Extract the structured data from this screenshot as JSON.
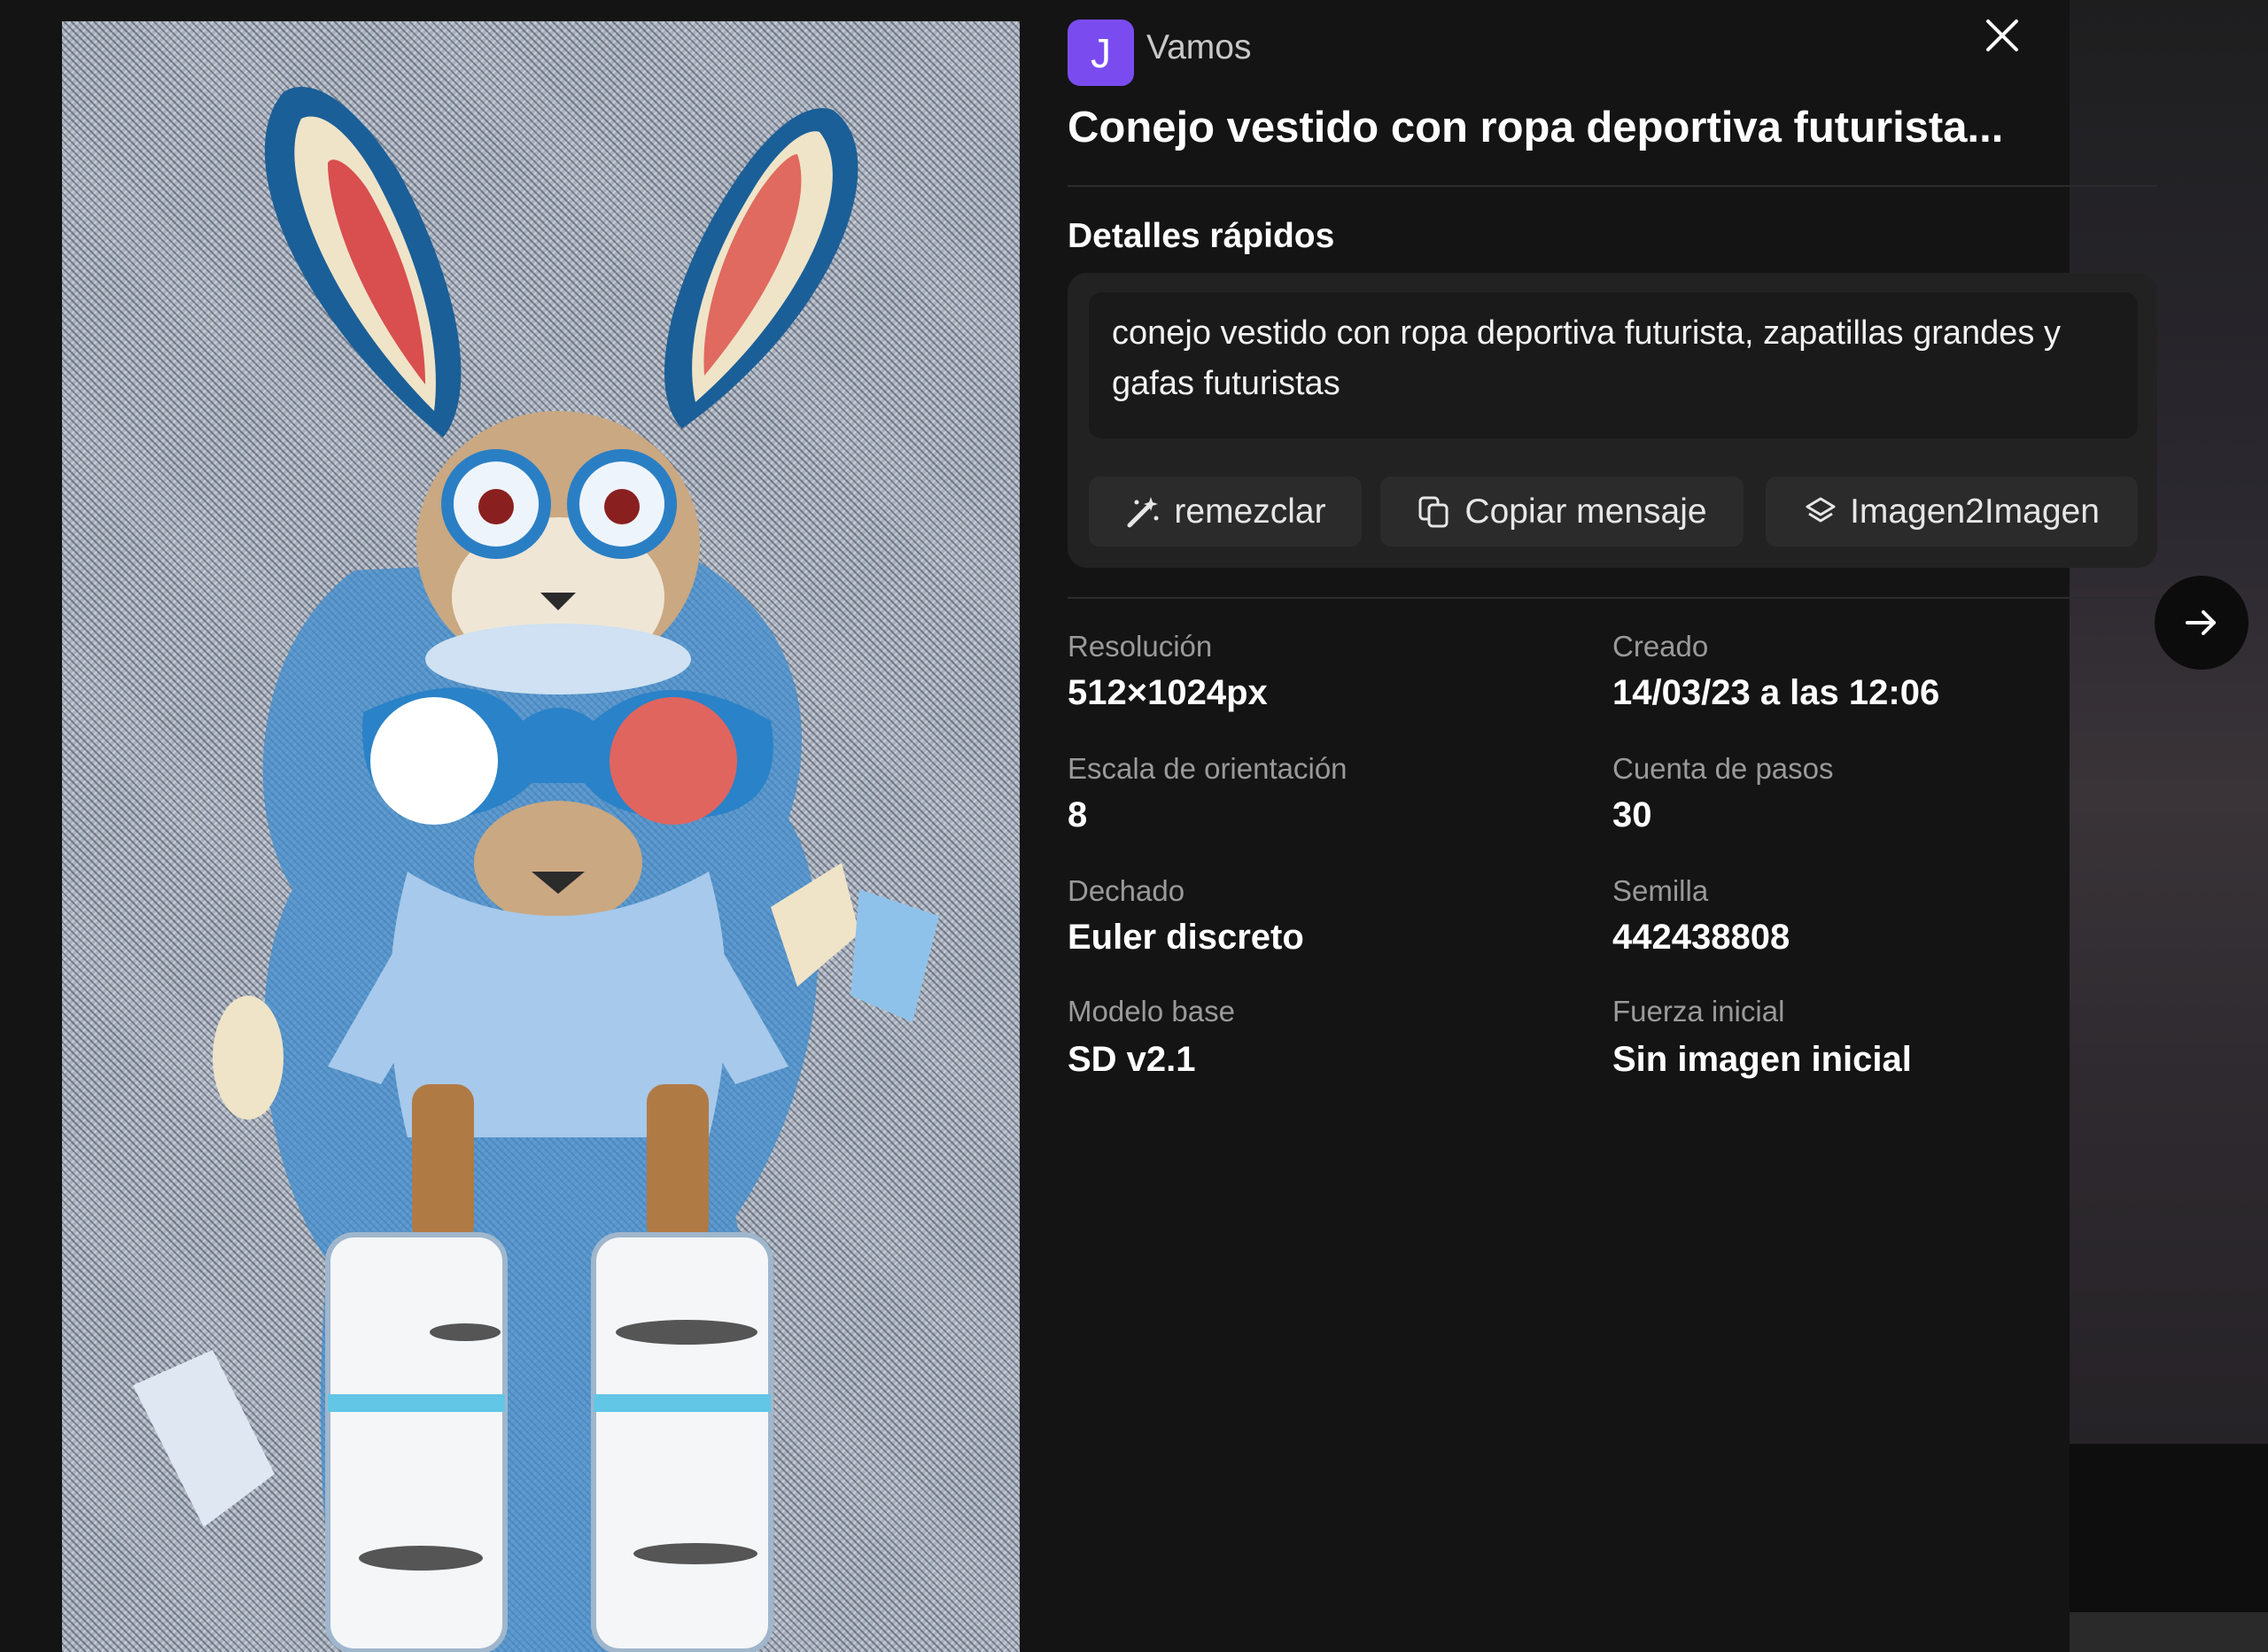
{
  "author": {
    "avatar_letter": "J",
    "name": "Vamos",
    "avatar_color": "#7a4cf0"
  },
  "title": "Conejo vestido con ropa deportiva futurista...",
  "quick_details": {
    "heading": "Detalles rápidos",
    "prompt": "conejo vestido con ropa deportiva futurista, zapatillas grandes y gafas futuristas",
    "actions": [
      {
        "label": "remezclar",
        "icon": "magic-wand-icon"
      },
      {
        "label": "Copiar mensaje",
        "icon": "copy-icon"
      },
      {
        "label": "Imagen2Imagen",
        "icon": "layers-icon"
      }
    ]
  },
  "stats": [
    {
      "label": "Resolución",
      "value": "512×1024px"
    },
    {
      "label": "Creado",
      "value": "14/03/23 a las 12:06"
    },
    {
      "label": "Escala de orientación",
      "value": "8"
    },
    {
      "label": "Cuenta de pasos",
      "value": "30"
    },
    {
      "label": "Dechado",
      "value": "Euler discreto"
    },
    {
      "label": "Semilla",
      "value": "442438808"
    },
    {
      "label": "Modelo base",
      "value": "SD v2.1"
    },
    {
      "label": "Fuerza inicial",
      "value": "Sin imagen inicial"
    }
  ],
  "icons": {
    "close": "close-icon",
    "next": "arrow-right-icon"
  }
}
